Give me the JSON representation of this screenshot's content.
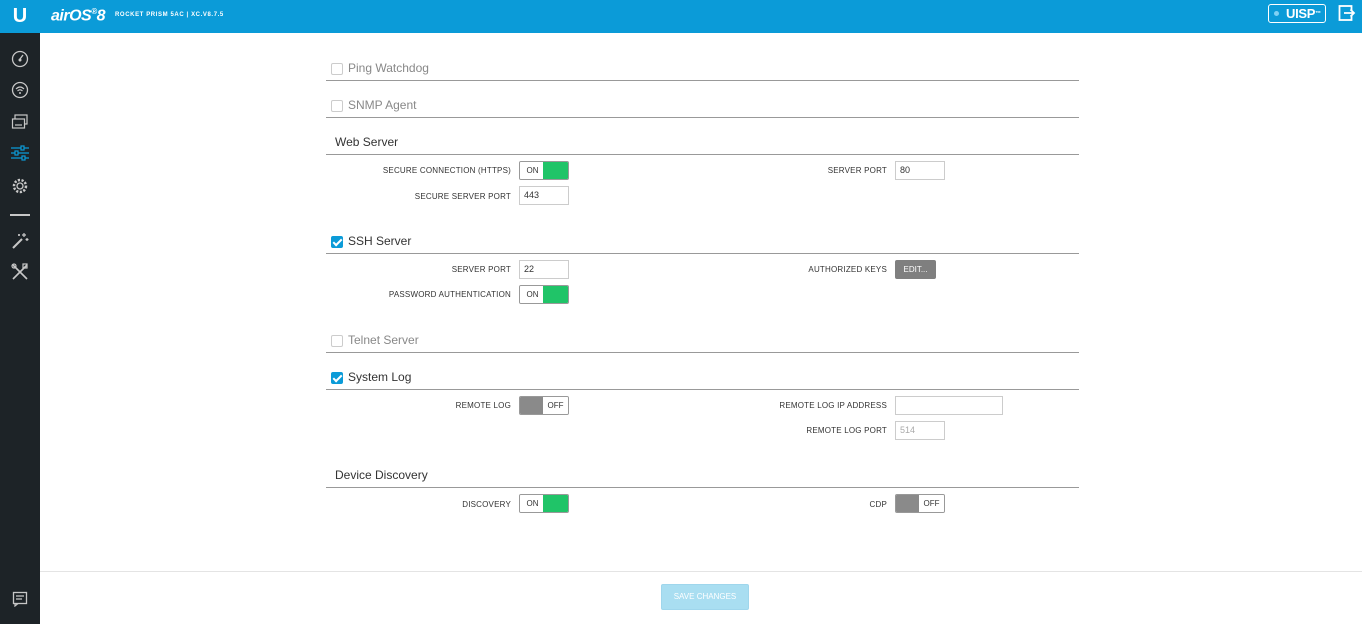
{
  "header": {
    "app_logo": "U",
    "brand": "airOS",
    "brand_version": "8",
    "device_info": "ROCKET PRISM 5AC | XC.V8.7.5",
    "uisp_label": "UISP",
    "uisp_mark": "™"
  },
  "sidebar": {
    "items": [
      {
        "icon": "dashboard-icon"
      },
      {
        "icon": "wireless-icon"
      },
      {
        "icon": "network-icon"
      },
      {
        "icon": "services-icon"
      },
      {
        "icon": "system-icon"
      },
      {
        "icon": "tools-icon"
      },
      {
        "icon": "utilities-icon"
      },
      {
        "icon": "log-icon"
      }
    ]
  },
  "sections": {
    "ping_watchdog": {
      "title": "Ping Watchdog",
      "checked": false
    },
    "snmp_agent": {
      "title": "SNMP Agent",
      "checked": false
    },
    "web_server": {
      "title": "Web Server",
      "secure_connection_label": "SECURE CONNECTION (HTTPS)",
      "secure_connection_state": "ON",
      "server_port_label": "SERVER PORT",
      "server_port_value": "80",
      "secure_server_port_label": "SECURE SERVER PORT",
      "secure_server_port_value": "443"
    },
    "ssh_server": {
      "title": "SSH Server",
      "checked": true,
      "server_port_label": "SERVER PORT",
      "server_port_value": "22",
      "authorized_keys_label": "AUTHORIZED KEYS",
      "edit_label": "EDIT...",
      "password_auth_label": "PASSWORD AUTHENTICATION",
      "password_auth_state": "ON"
    },
    "telnet_server": {
      "title": "Telnet Server",
      "checked": false
    },
    "system_log": {
      "title": "System Log",
      "checked": true,
      "remote_log_label": "REMOTE LOG",
      "remote_log_state": "OFF",
      "remote_log_ip_label": "REMOTE LOG IP ADDRESS",
      "remote_log_ip_value": "",
      "remote_log_port_label": "REMOTE LOG PORT",
      "remote_log_port_value": "514"
    },
    "device_discovery": {
      "title": "Device Discovery",
      "discovery_label": "DISCOVERY",
      "discovery_state": "ON",
      "cdp_label": "CDP",
      "cdp_state": "OFF"
    }
  },
  "footer": {
    "save_label": "SAVE CHANGES"
  },
  "colors": {
    "topbar": "#0b9bd8",
    "sidebar": "#1d2327",
    "toggle_on": "#20c468",
    "toggle_off": "#8a8a8a",
    "save_disabled": "#a9def1"
  }
}
